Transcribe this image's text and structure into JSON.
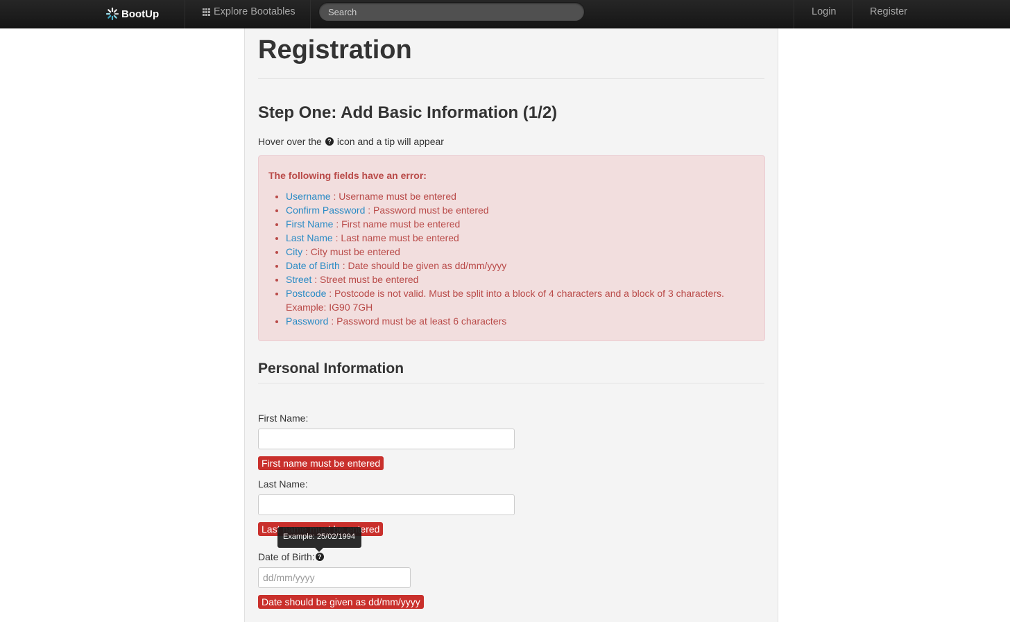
{
  "navbar": {
    "brand": "BootUp",
    "explore_label": "Explore Bootables",
    "search_placeholder": "Search",
    "login_label": "Login",
    "register_label": "Register"
  },
  "page": {
    "title": "Registration",
    "step_title": "Step One: Add Basic Information (1/2)",
    "hint_before": "Hover over the",
    "hint_after": "icon and a tip will appear"
  },
  "errors": {
    "title": "The following fields have an error:",
    "items": [
      {
        "field": "Username",
        "message": " : Username must be entered"
      },
      {
        "field": "Confirm Password",
        "message": " : Password must be entered"
      },
      {
        "field": "First Name",
        "message": " : First name must be entered"
      },
      {
        "field": "Last Name",
        "message": " : Last name must be entered"
      },
      {
        "field": "City",
        "message": " : City must be entered"
      },
      {
        "field": "Date of Birth",
        "message": " : Date should be given as dd/mm/yyyy"
      },
      {
        "field": "Street",
        "message": " : Street must be entered"
      },
      {
        "field": "Postcode",
        "message": " : Postcode is not valid. Must be split into a block of 4 characters and a block of 3 characters. Example: IG90 7GH"
      },
      {
        "field": "Password",
        "message": " : Password must be at least 6 characters"
      }
    ]
  },
  "personal": {
    "section_title": "Personal Information",
    "first_name_label": "First Name:",
    "first_name_value": "",
    "first_name_error": "First name must be entered",
    "last_name_label": "Last Name:",
    "last_name_value": "",
    "last_name_error": "Last name must be entered",
    "dob_label": "Date of Birth:",
    "dob_placeholder": "dd/mm/yyyy",
    "dob_error": "Date should be given as dd/mm/yyyy",
    "dob_tooltip": "Example: 25/02/1994"
  },
  "icons": {
    "brand_logo": "bootup-spinner-logo",
    "explore": "grid-icon",
    "help": "question-circle-icon"
  },
  "colors": {
    "navbar": "#1e1e1e",
    "alert_bg": "#f2dede",
    "alert_text": "#b94a48",
    "link": "#2a8bc5",
    "error_badge": "#c9302c"
  }
}
